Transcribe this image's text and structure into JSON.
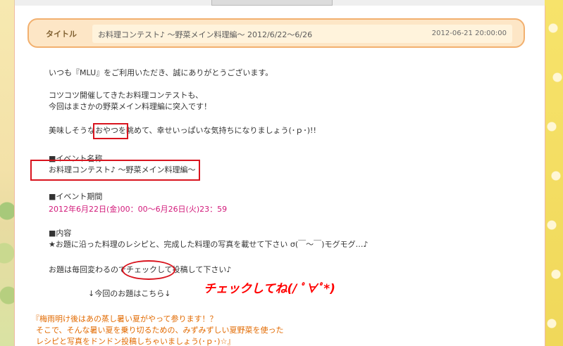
{
  "header": {
    "label": "タイトル",
    "title": "お料理コンテスト♪ ～野菜メイン料理編～  2012/6/22～6/26",
    "datetime": "2012-06-21 20:00:00"
  },
  "body": {
    "greeting": "いつも『MLU』をご利用いただき、誠にありがとうございます。",
    "intro_line1": "コツコツ開催してきたお料理コンテストも、",
    "intro_line2": "今回はまさかの野菜メイン料理編に突入です！",
    "enjoy_pre": "美味しそうな",
    "enjoy_boxed": "おやつを",
    "enjoy_post": "眺めて、幸せいっぱいな気持ちになりましょう(･ｐ･)!!",
    "event_name_heading": "■イベント名称",
    "event_name": "お料理コンテスト♪ ～野菜メイン料理編～",
    "event_period_heading": "■イベント期間",
    "event_period": "2012年6月22日(金)00：00～6月26日(火)23：59",
    "content_heading": "■内容",
    "content_text": "★お題に沿った料理のレシピと、完成した料理の写真を載せて下さい σ(￣～￣)モグモグ…♪",
    "theme_pre": "お題は毎回変わるので",
    "theme_oval": "チェックして",
    "theme_post": "投稿して下さい♪",
    "theme_pointer": "↓今回のお題はこちら↓",
    "theme_quote1": "『梅雨明け後はあの蒸し暑い夏がやって参ります！？",
    "theme_quote2": "そこで、そんな暑い夏を乗り切るための、みずみずしい夏野菜を使った",
    "theme_quote3": "レシピと写真をドンドン投稿しちゃいましょう(･ｐ･)☆』"
  },
  "annotation": {
    "text": "チェックしてね(/ ﾟ∀ﾟ*)"
  },
  "colors": {
    "header_border": "#f2b06f",
    "header_bg": "#fde6c6",
    "highlight_red": "#d9141e",
    "period_pink": "#d2197a",
    "quote_orange": "#e26a00"
  }
}
